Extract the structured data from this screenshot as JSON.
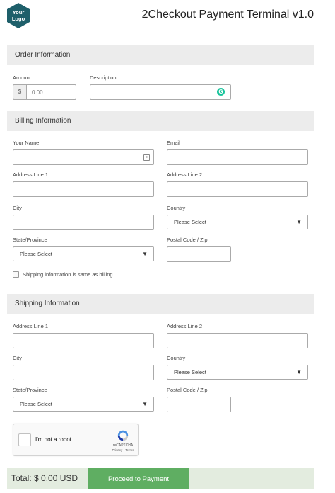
{
  "header": {
    "logo_line1": "Your",
    "logo_line2": "Logo",
    "title": "2Checkout Payment Terminal v1.0"
  },
  "order": {
    "section_title": "Order Information",
    "amount_label": "Amount",
    "amount_prefix": "$",
    "amount_placeholder": "0.00",
    "description_label": "Description"
  },
  "billing": {
    "section_title": "Billing Information",
    "name_label": "Your Name",
    "email_label": "Email",
    "address1_label": "Address Line 1",
    "address2_label": "Address Line 2",
    "city_label": "City",
    "country_label": "Country",
    "country_value": "Please Select",
    "state_label": "State/Province",
    "state_value": "Please Select",
    "zip_label": "Postal Code / Zip",
    "same_as_billing_label": "Shipping information is same as billing"
  },
  "shipping": {
    "section_title": "Shipping Information",
    "address1_label": "Address Line 1",
    "address2_label": "Address Line 2",
    "city_label": "City",
    "country_label": "Country",
    "country_value": "Please Select",
    "state_label": "State/Province",
    "state_value": "Please Select",
    "zip_label": "Postal Code / Zip"
  },
  "captcha": {
    "label": "I'm not a robot",
    "brand": "reCAPTCHA",
    "terms": "Privacy - Terms"
  },
  "footer": {
    "total_text": "Total: $ 0.00  USD",
    "pay_button": "Proceed to Payment"
  },
  "colors": {
    "logo_bg": "#1e5f6a",
    "pay_button": "#5fae62",
    "footer_bg": "#e3ecdf",
    "grammarly": "#15c39a"
  }
}
